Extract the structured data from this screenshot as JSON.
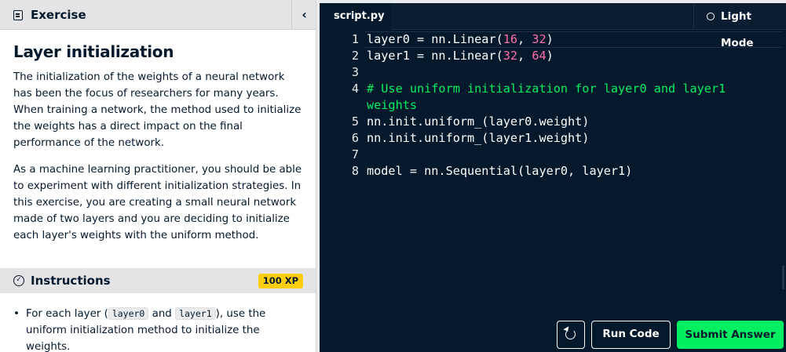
{
  "exercise_panel": {
    "header_title": "Exercise",
    "collapse_glyph": "‹",
    "title": "Layer initialization",
    "paragraphs": [
      "The initialization of the weights of a neural network has been the focus of researchers for many years. When training a network, the method used to initialize the weights has a direct impact on the final performance of the network.",
      "As a machine learning practitioner, you should be able to experiment with different initialization strategies. In this exercise, you are creating a small neural network made of two layers and you are deciding to initialize each layer's weights with the uniform method."
    ]
  },
  "instructions_panel": {
    "header_title": "Instructions",
    "xp_badge": "100 XP",
    "items": [
      {
        "bullet": "•",
        "text_before": "For each layer (",
        "code1": "layer0",
        "text_middle": " and ",
        "code2": "layer1",
        "text_after": "), use the uniform initialization method to initialize the weights."
      }
    ]
  },
  "editor": {
    "tab_label": "script.py",
    "mode_toggle_label": "Light Mode",
    "lines": [
      {
        "n": "1",
        "parts": [
          {
            "t": "layer0 = nn.Linear(",
            "c": ""
          },
          {
            "t": "16",
            "c": "num"
          },
          {
            "t": ", ",
            "c": ""
          },
          {
            "t": "32",
            "c": "num"
          },
          {
            "t": ")",
            "c": ""
          }
        ]
      },
      {
        "n": "2",
        "parts": [
          {
            "t": "layer1 = nn.Linear(",
            "c": ""
          },
          {
            "t": "32",
            "c": "num"
          },
          {
            "t": ", ",
            "c": ""
          },
          {
            "t": "64",
            "c": "num"
          },
          {
            "t": ")",
            "c": ""
          }
        ]
      },
      {
        "n": "3",
        "parts": [
          {
            "t": "",
            "c": ""
          }
        ]
      },
      {
        "n": "4",
        "parts": [
          {
            "t": "# Use uniform initialization for layer0 and layer1 weights",
            "c": "cmt"
          }
        ]
      },
      {
        "n": "5",
        "parts": [
          {
            "t": "nn.init.uniform_(layer0.weight)",
            "c": ""
          }
        ]
      },
      {
        "n": "6",
        "parts": [
          {
            "t": "nn.init.uniform_(layer1.weight)",
            "c": ""
          }
        ]
      },
      {
        "n": "7",
        "parts": [
          {
            "t": "",
            "c": ""
          }
        ]
      },
      {
        "n": "8",
        "parts": [
          {
            "t": "model = nn.Sequential(layer0, layer1)",
            "c": ""
          }
        ]
      }
    ],
    "run_label": "Run Code",
    "submit_label": "Submit Answer"
  },
  "colors": {
    "editor_bg": "#05192d",
    "number": "#ff6ea9",
    "comment": "#03ef62",
    "submit_bg": "#03ef62",
    "xp_badge_bg": "#fcce0d"
  }
}
